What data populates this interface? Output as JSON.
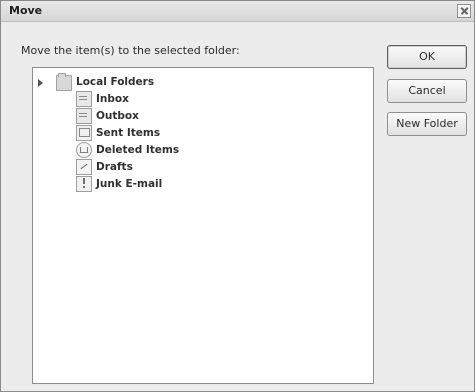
{
  "dialog": {
    "title": "Move",
    "prompt": "Move the item(s) to the selected folder:"
  },
  "buttons": {
    "ok": "OK",
    "cancel": "Cancel",
    "new_folder": "New Folder"
  },
  "folders": {
    "root": "Local Folders",
    "items": [
      {
        "label": "Inbox",
        "icon": "inbox-icon"
      },
      {
        "label": "Outbox",
        "icon": "outbox-icon"
      },
      {
        "label": "Sent Items",
        "icon": "sent-items-icon"
      },
      {
        "label": "Deleted Items",
        "icon": "deleted-items-icon"
      },
      {
        "label": "Drafts",
        "icon": "drafts-icon"
      },
      {
        "label": "Junk E-mail",
        "icon": "junk-email-icon"
      }
    ]
  }
}
